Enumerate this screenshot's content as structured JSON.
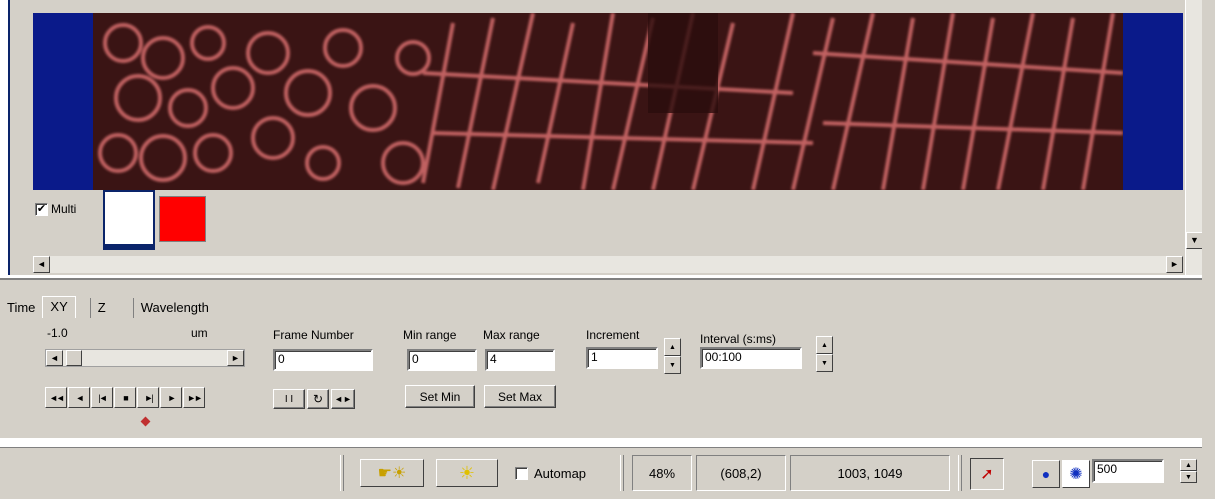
{
  "multi": {
    "label": "Multi",
    "checked": true
  },
  "tabs": [
    {
      "label": "Time"
    },
    {
      "label": "XY"
    },
    {
      "label": "Z"
    },
    {
      "label": "Wavelength"
    }
  ],
  "controls": {
    "position_value": "-1.0",
    "position_unit": "um",
    "frame_number_label": "Frame Number",
    "frame_number_value": "0",
    "min_range_label": "Min range",
    "min_range_value": "0",
    "max_range_label": "Max range",
    "max_range_value": "4",
    "set_min_label": "Set Min",
    "set_max_label": "Set Max",
    "increment_label": "Increment",
    "increment_value": "1",
    "interval_label": "Interval (s:ms)",
    "interval_value": "00:100"
  },
  "status": {
    "automap_label": "Automap",
    "automap_checked": false,
    "zoom": "48%",
    "cursor_pos": "(608,2)",
    "image_size": "1003, 1049",
    "value_field": "500"
  },
  "colors": {
    "background_blue": "#0a1a8a",
    "channel_red": "#ff0000",
    "specimen_tint": "#c85a5a"
  }
}
